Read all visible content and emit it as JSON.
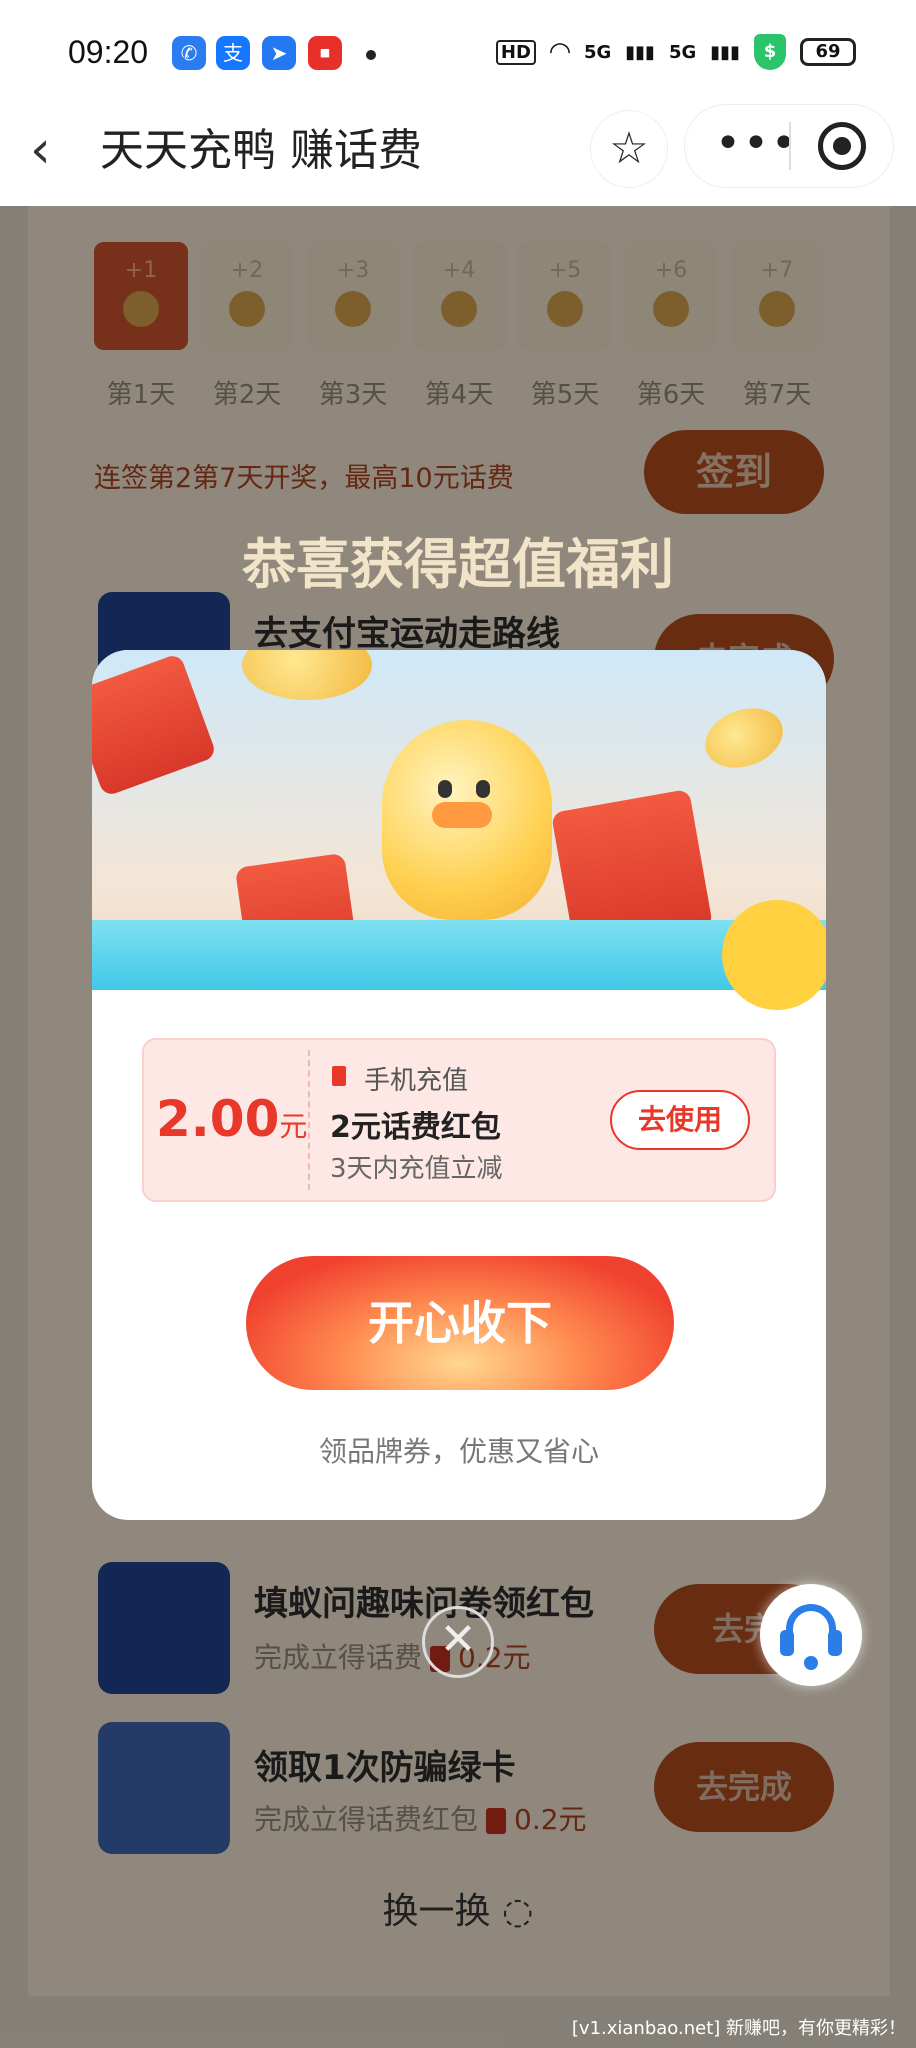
{
  "status_bar": {
    "time": "09:20",
    "hd": "HD",
    "net1": "5G",
    "net2": "5G",
    "battery": "69",
    "app_icons": [
      "phone-app-icon",
      "alipay-icon",
      "direction-app-icon",
      "news-app-icon"
    ]
  },
  "nav": {
    "title": "天天充鸭 赚话费",
    "back_icon": "‹",
    "fav_icon": "☆",
    "more_icon": "•••"
  },
  "checkin": {
    "days": [
      {
        "bonus": "+1",
        "label": "第1天"
      },
      {
        "bonus": "+2",
        "label": "第2天"
      },
      {
        "bonus": "+3",
        "label": "第3天"
      },
      {
        "bonus": "+4",
        "label": "第4天"
      },
      {
        "bonus": "+5",
        "label": "第5天"
      },
      {
        "bonus": "+6",
        "label": "第6天"
      },
      {
        "bonus": "+7",
        "label": "第7天"
      }
    ],
    "streak_text": "连签第2第7天开奖，最高10元话费",
    "signin_label": "签到"
  },
  "congrats": "恭喜获得超值福利",
  "tasks": [
    {
      "title": "去支付宝运动走路线",
      "btn": "去完成"
    },
    {
      "title": "填蚁问趣味问卷领红包",
      "sub": "完成立得话费",
      "amount": "0.2元",
      "btn": "去完"
    },
    {
      "title": "领取1次防骗绿卡",
      "sub": "完成立得话费红包",
      "amount": "0.2元",
      "btn": "去完成"
    }
  ],
  "refresh_label": "换一换",
  "modal": {
    "coupon": {
      "amount": "2.00",
      "unit": "元",
      "category": "手机充值",
      "name": "2元话费红包",
      "desc": "3天内充值立减",
      "use_label": "去使用"
    },
    "accept_label": "开心收下",
    "note": "领品牌券，优惠又省心"
  },
  "close_icon": "✕",
  "watermark": "[v1.xianbao.net] 新赚吧，有你更精彩！",
  "colors": {
    "accent": "#e8382a",
    "task_icon_bg": "#1e3f87",
    "cs_blue": "#2b7de8"
  }
}
